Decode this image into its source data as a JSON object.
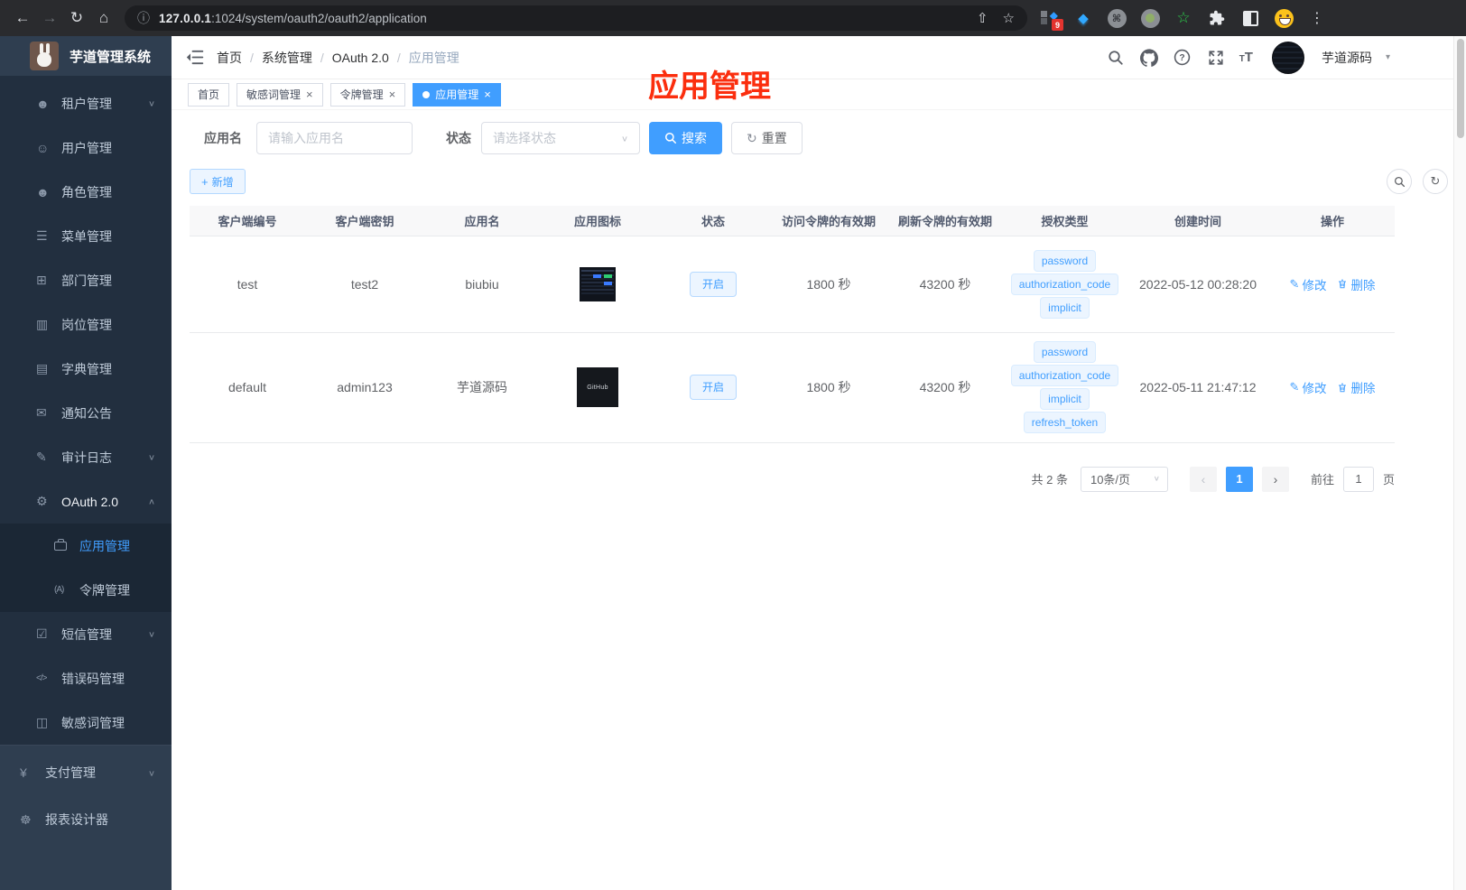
{
  "browser": {
    "url_host": "127.0.0.1",
    "url_port_path": ":1024/system/oauth2/oauth2/application",
    "ext_badge": "9"
  },
  "icons": {
    "back": "←",
    "forward": "→",
    "refresh": "↻",
    "home": "⌂",
    "info": "ⓘ",
    "share": "⇧",
    "star": "☆",
    "kebab": "⋮",
    "cmd": "⌘",
    "gem": "◆",
    "green_star": "☆",
    "close": "×",
    "caret_down": "∨",
    "caret_up": "∧",
    "select_caret": "∨",
    "plus": "+",
    "reset": "↻",
    "edit_pencil": "✎",
    "prev": "‹",
    "next": "›",
    "user_caret": "▾"
  },
  "annotation": {
    "text": "应用管理"
  },
  "sidebar": {
    "title": "芋道管理系统",
    "items": [
      {
        "label": "租户管理",
        "icon": "tenant-users-icon",
        "glyph": "☻",
        "chevron": "∨"
      },
      {
        "label": "用户管理",
        "icon": "user-icon",
        "glyph": "☺"
      },
      {
        "label": "角色管理",
        "icon": "role-icon",
        "glyph": "☻"
      },
      {
        "label": "菜单管理",
        "icon": "menu-tree-icon",
        "glyph": "☰"
      },
      {
        "label": "部门管理",
        "icon": "dept-org-icon",
        "glyph": "⊞"
      },
      {
        "label": "岗位管理",
        "icon": "post-badge-icon",
        "glyph": "▥"
      },
      {
        "label": "字典管理",
        "icon": "dict-book-icon",
        "glyph": "▤"
      },
      {
        "label": "通知公告",
        "icon": "notice-message-icon",
        "glyph": "✉"
      },
      {
        "label": "审计日志",
        "icon": "audit-log-icon",
        "glyph": "✎",
        "chevron": "∨"
      },
      {
        "label": "OAuth 2.0",
        "icon": "oauth-robot-icon",
        "glyph": "⚙",
        "chevron": "∧"
      },
      {
        "label": "应用管理",
        "icon": "app-briefcase-icon"
      },
      {
        "label": "令牌管理",
        "icon": "token-signal-icon",
        "glyph": "(A)"
      },
      {
        "label": "短信管理",
        "icon": "sms-shield-icon",
        "glyph": "☑",
        "chevron": "∨"
      },
      {
        "label": "错误码管理",
        "icon": "errorcode-icon",
        "glyph": "</>"
      },
      {
        "label": "敏感词管理",
        "icon": "sensitive-book-icon",
        "glyph": "◫"
      },
      {
        "label": "支付管理",
        "icon": "pay-yen-icon",
        "glyph": "¥",
        "chevron": "∨"
      },
      {
        "label": "报表设计器",
        "icon": "report-designer-icon",
        "glyph": "☸"
      }
    ]
  },
  "navbar": {
    "breadcrumb": [
      "首页",
      "系统管理",
      "OAuth 2.0",
      "应用管理"
    ],
    "username": "芋道源码"
  },
  "tabs": [
    {
      "label": "首页"
    },
    {
      "label": "敏感词管理"
    },
    {
      "label": "令牌管理"
    },
    {
      "label": "应用管理"
    }
  ],
  "filters": {
    "name_label": "应用名",
    "name_placeholder": "请输入应用名",
    "status_label": "状态",
    "status_placeholder": "请选择状态",
    "search_label": "搜索",
    "reset_label": "重置"
  },
  "toolbar": {
    "add_label": "新增"
  },
  "table": {
    "headers": [
      "客户端编号",
      "客户端密钥",
      "应用名",
      "应用图标",
      "状态",
      "访问令牌的有效期",
      "刷新令牌的有效期",
      "授权类型",
      "创建时间",
      "操作"
    ],
    "actions": {
      "edit": "修改",
      "delete": "删除"
    },
    "rows": [
      {
        "client_id": "test",
        "secret": "test2",
        "name": "biubiu",
        "status": "开启",
        "access_ttl": "1800 秒",
        "refresh_ttl": "43200 秒",
        "grants": [
          "password",
          "authorization_code",
          "implicit"
        ],
        "created": "2022-05-12 00:28:20",
        "icon_text": ""
      },
      {
        "client_id": "default",
        "secret": "admin123",
        "name": "芋道源码",
        "status": "开启",
        "access_ttl": "1800 秒",
        "refresh_ttl": "43200 秒",
        "grants": [
          "password",
          "authorization_code",
          "implicit",
          "refresh_token"
        ],
        "created": "2022-05-11 21:47:12",
        "icon_text": "GitHub"
      }
    ]
  },
  "pagination": {
    "total": "共 2 条",
    "page_size": "10条/页",
    "current": "1",
    "goto_label": "前往",
    "goto_value": "1",
    "page_label": "页"
  }
}
